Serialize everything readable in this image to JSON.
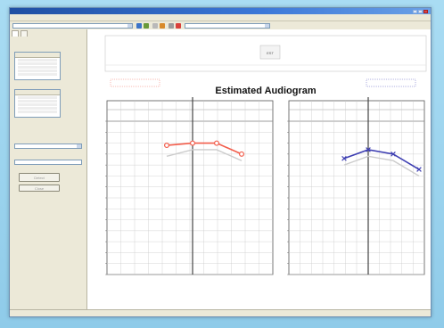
{
  "chart_data": [
    {
      "type": "line",
      "title": "Estimated Audiogram",
      "ear": "right",
      "series": [
        {
          "values": [
            2,
            0,
            0,
            10
          ],
          "color": "#f25c4a",
          "marker": "circle"
        },
        {
          "values": [
            12,
            6,
            6,
            16
          ],
          "color": "#cccccc",
          "marker": "none"
        }
      ],
      "color": "#f25c4a"
    },
    {
      "type": "line",
      "ear": "left",
      "series": [
        {
          "values": [
            14,
            6,
            10,
            24
          ],
          "color": "#3e3fb2",
          "marker": "x"
        },
        {
          "values": [
            20,
            12,
            16,
            30
          ],
          "color": "#cccccc",
          "marker": "none"
        }
      ],
      "color": "#3e3fb2"
    }
  ],
  "main": {
    "header_label": "EST",
    "detect_button": "Detect",
    "close_button": "Close"
  },
  "colors": {
    "right_ear": "#f25c4a",
    "left_ear": "#3e3fb2",
    "reference": "#cccccc",
    "window_border": "#6b8fb4"
  }
}
